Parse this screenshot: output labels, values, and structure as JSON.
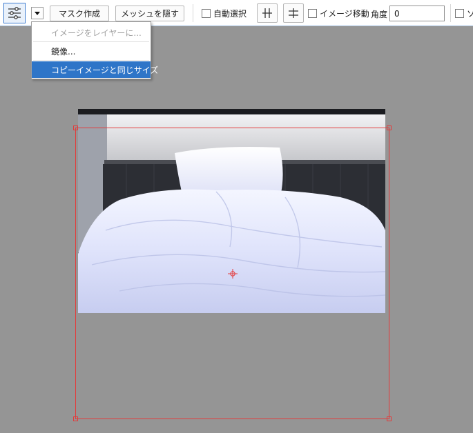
{
  "toolbar": {
    "settings_icon": "sliders-icon",
    "dropdown_icon": "triangle-down-icon",
    "mask_button": "マスク作成",
    "hide_mesh_button": "メッシュを隠す",
    "auto_select_label": "自動選択",
    "auto_select_checked": false,
    "flip_horizontal_icon": "vertical-bars-icon",
    "flip_vertical_icon": "horizontal-bars-icon",
    "move_image_label": "イメージ移動",
    "move_image_checked": false,
    "angle_label": "角度",
    "angle_value": "0",
    "cut_label": "ソ",
    "cut_checked": false
  },
  "menu": {
    "items": [
      {
        "label": "イメージをレイヤーに...",
        "state": "disabled"
      },
      {
        "label": "鏡像...",
        "state": "normal"
      },
      {
        "label": "コピーイメージと同じサイズ",
        "state": "selected"
      }
    ]
  },
  "canvas": {
    "background": "#959595",
    "mesh_color": "#e43a3a",
    "photo_subject": "bed with white linens under a lit headboard shelf"
  }
}
